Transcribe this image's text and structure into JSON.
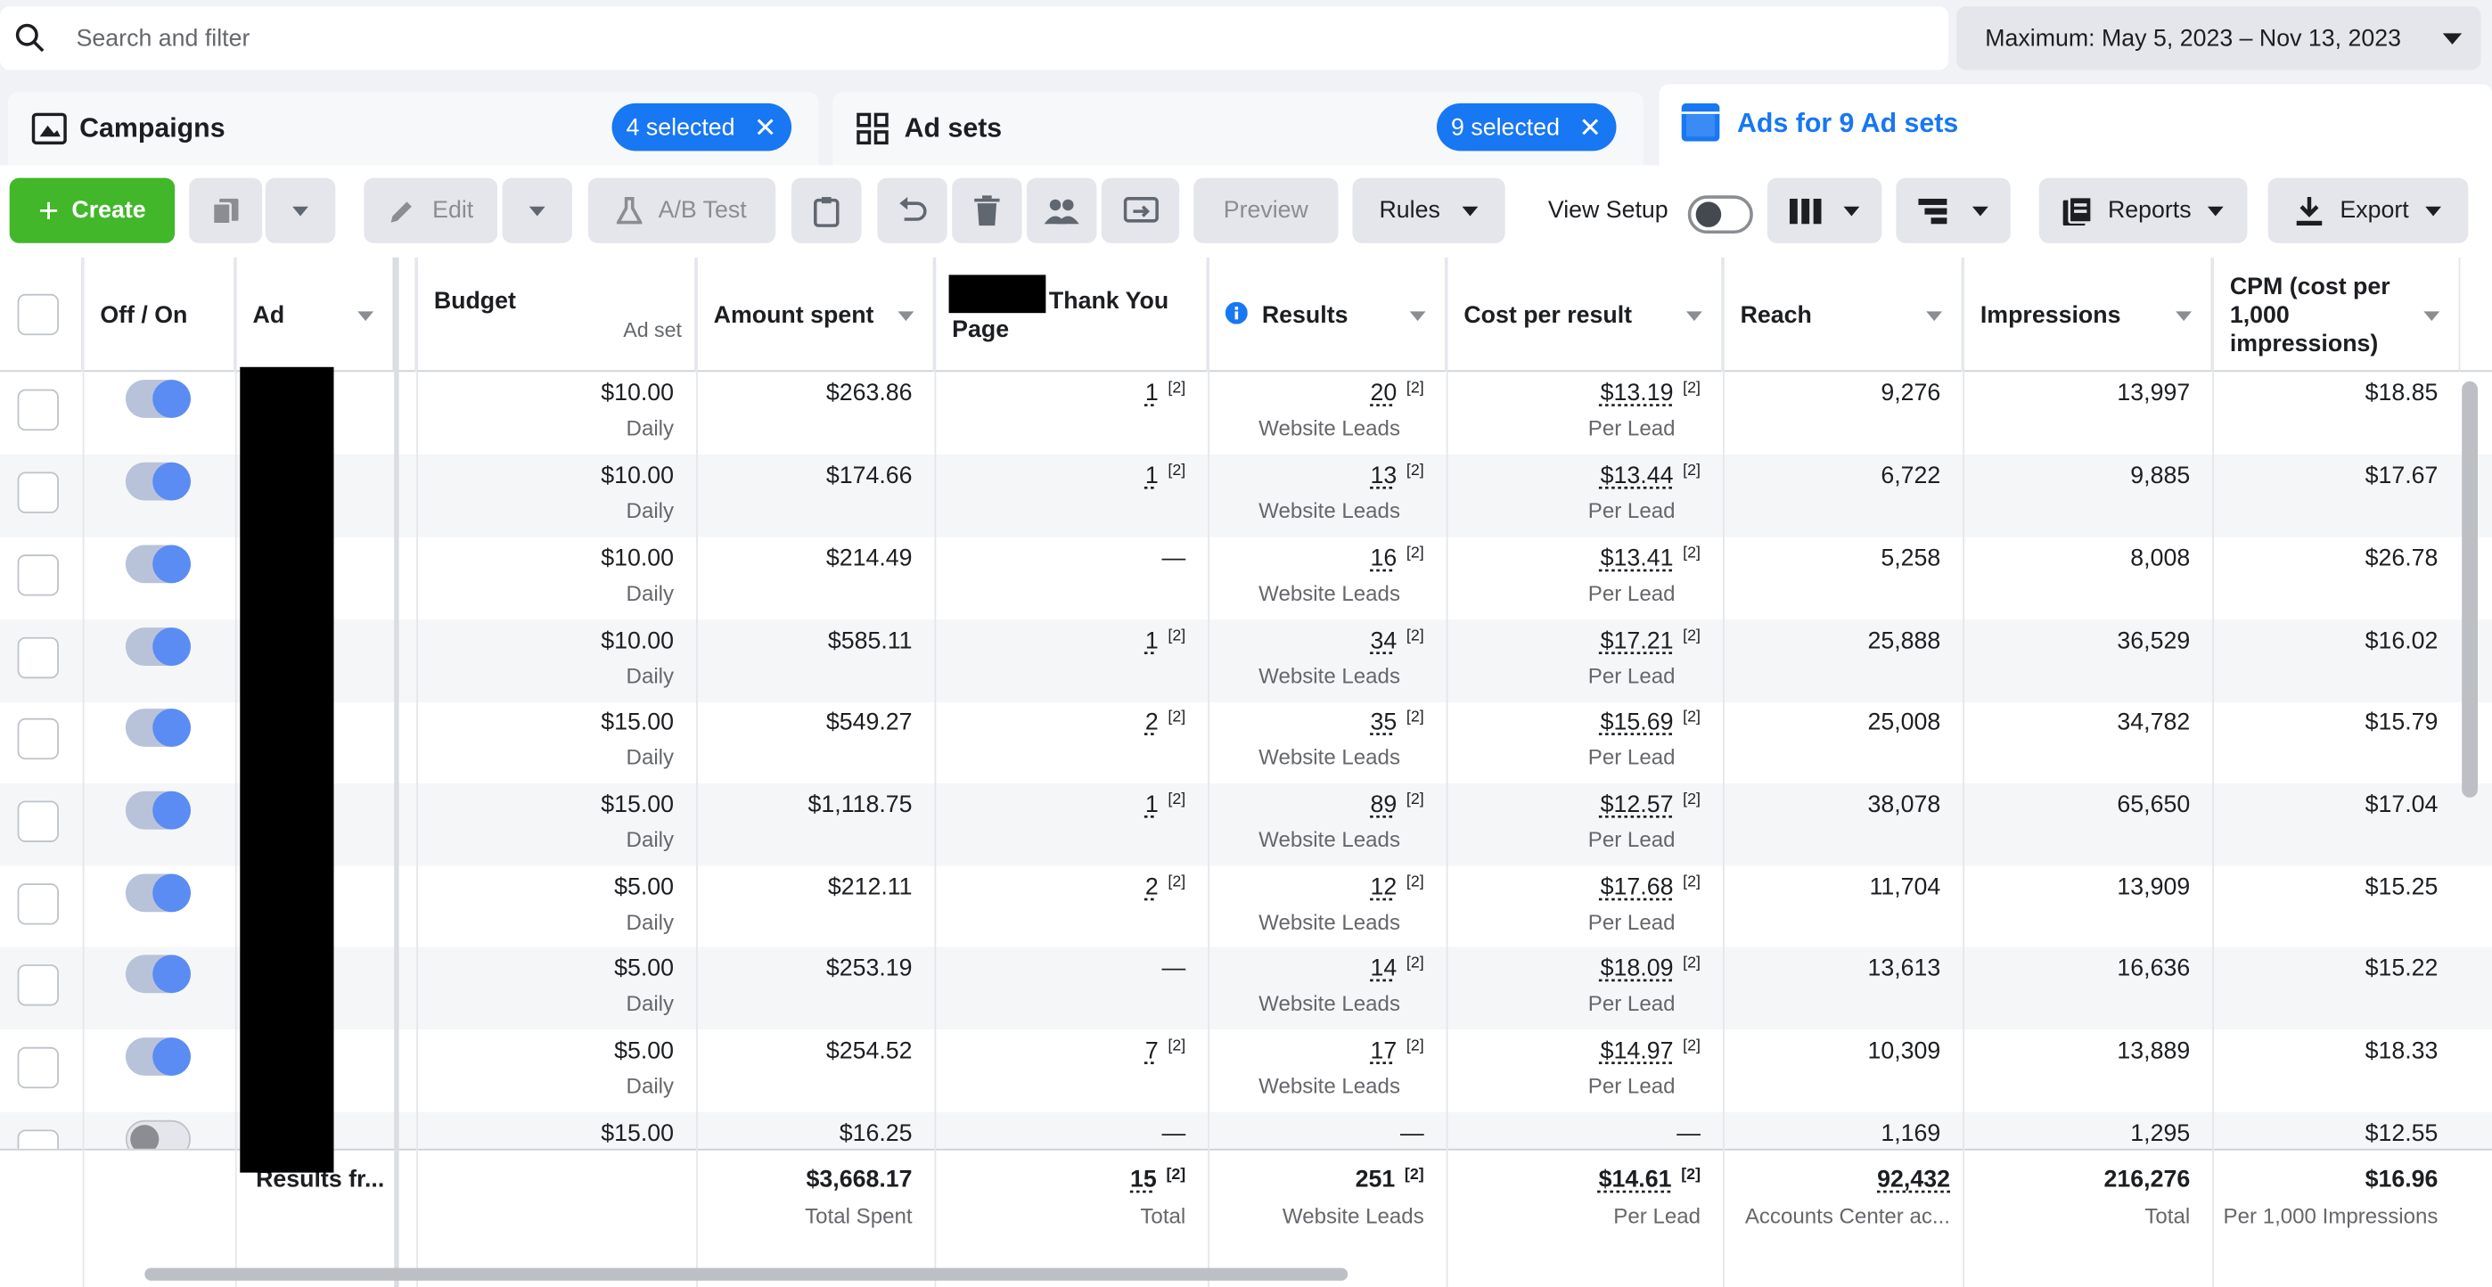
{
  "search": {
    "placeholder": "Search and filter"
  },
  "date_range": "Maximum: May 5, 2023 – Nov 13, 2023",
  "tabs": [
    {
      "label": "Campaigns",
      "selected": "4 selected"
    },
    {
      "label": "Ad sets",
      "selected": "9 selected"
    },
    {
      "label": "Ads for 9 Ad sets"
    }
  ],
  "toolbar": {
    "create": "Create",
    "edit": "Edit",
    "ab_test": "A/B Test",
    "preview": "Preview",
    "rules": "Rules",
    "view_setup": "View Setup",
    "reports": "Reports",
    "export": "Export"
  },
  "columns": {
    "onoff": "Off / On",
    "ad": "Ad",
    "budget": "Budget",
    "budget_sub": "Ad set",
    "amount_spent": "Amount spent",
    "thank_you": "Thank You",
    "thank_you_2": "Page",
    "results": "Results",
    "cost_per_result": "Cost per result",
    "reach": "Reach",
    "impressions": "Impressions",
    "cpm": "CPM (cost per",
    "cpm_2": "1,000",
    "cpm_3": "impressions)"
  },
  "rows": [
    {
      "on": true,
      "budget": "$10.00",
      "budget_sub": "Daily",
      "spent": "$263.86",
      "thank": "1",
      "thank_fn": "[2]",
      "results": "20",
      "results_fn": "[2]",
      "results_sub": "Website Leads",
      "cpr": "$13.19",
      "cpr_fn": "[2]",
      "cpr_sub": "Per Lead",
      "reach": "9,276",
      "impr": "13,997",
      "cpm": "$18.85"
    },
    {
      "on": true,
      "budget": "$10.00",
      "budget_sub": "Daily",
      "spent": "$174.66",
      "thank": "1",
      "thank_fn": "[2]",
      "results": "13",
      "results_fn": "[2]",
      "results_sub": "Website Leads",
      "cpr": "$13.44",
      "cpr_fn": "[2]",
      "cpr_sub": "Per Lead",
      "reach": "6,722",
      "impr": "9,885",
      "cpm": "$17.67"
    },
    {
      "on": true,
      "budget": "$10.00",
      "budget_sub": "Daily",
      "spent": "$214.49",
      "thank": "—",
      "thank_fn": "",
      "results": "16",
      "results_fn": "[2]",
      "results_sub": "Website Leads",
      "cpr": "$13.41",
      "cpr_fn": "[2]",
      "cpr_sub": "Per Lead",
      "reach": "5,258",
      "impr": "8,008",
      "cpm": "$26.78"
    },
    {
      "on": true,
      "budget": "$10.00",
      "budget_sub": "Daily",
      "spent": "$585.11",
      "thank": "1",
      "thank_fn": "[2]",
      "results": "34",
      "results_fn": "[2]",
      "results_sub": "Website Leads",
      "cpr": "$17.21",
      "cpr_fn": "[2]",
      "cpr_sub": "Per Lead",
      "reach": "25,888",
      "impr": "36,529",
      "cpm": "$16.02"
    },
    {
      "on": true,
      "budget": "$15.00",
      "budget_sub": "Daily",
      "spent": "$549.27",
      "thank": "2",
      "thank_fn": "[2]",
      "results": "35",
      "results_fn": "[2]",
      "results_sub": "Website Leads",
      "cpr": "$15.69",
      "cpr_fn": "[2]",
      "cpr_sub": "Per Lead",
      "reach": "25,008",
      "impr": "34,782",
      "cpm": "$15.79"
    },
    {
      "on": true,
      "budget": "$15.00",
      "budget_sub": "Daily",
      "spent": "$1,118.75",
      "thank": "1",
      "thank_fn": "[2]",
      "results": "89",
      "results_fn": "[2]",
      "results_sub": "Website Leads",
      "cpr": "$12.57",
      "cpr_fn": "[2]",
      "cpr_sub": "Per Lead",
      "reach": "38,078",
      "impr": "65,650",
      "cpm": "$17.04"
    },
    {
      "on": true,
      "budget": "$5.00",
      "budget_sub": "Daily",
      "spent": "$212.11",
      "thank": "2",
      "thank_fn": "[2]",
      "results": "12",
      "results_fn": "[2]",
      "results_sub": "Website Leads",
      "cpr": "$17.68",
      "cpr_fn": "[2]",
      "cpr_sub": "Per Lead",
      "reach": "11,704",
      "impr": "13,909",
      "cpm": "$15.25"
    },
    {
      "on": true,
      "budget": "$5.00",
      "budget_sub": "Daily",
      "spent": "$253.19",
      "thank": "—",
      "thank_fn": "",
      "results": "14",
      "results_fn": "[2]",
      "results_sub": "Website Leads",
      "cpr": "$18.09",
      "cpr_fn": "[2]",
      "cpr_sub": "Per Lead",
      "reach": "13,613",
      "impr": "16,636",
      "cpm": "$15.22"
    },
    {
      "on": true,
      "budget": "$5.00",
      "budget_sub": "Daily",
      "spent": "$254.52",
      "thank": "7",
      "thank_fn": "[2]",
      "results": "17",
      "results_fn": "[2]",
      "results_sub": "Website Leads",
      "cpr": "$14.97",
      "cpr_fn": "[2]",
      "cpr_sub": "Per Lead",
      "reach": "10,309",
      "impr": "13,889",
      "cpm": "$18.33"
    },
    {
      "on": false,
      "budget": "$15.00",
      "budget_sub": "",
      "spent": "$16.25",
      "thank": "—",
      "thank_fn": "",
      "results": "—",
      "results_fn": "",
      "results_sub": "",
      "cpr": "—",
      "cpr_fn": "",
      "cpr_sub": "",
      "reach": "1,169",
      "impr": "1,295",
      "cpm": "$12.55"
    }
  ],
  "totals": {
    "label": "Results fr...",
    "spent": "$3,668.17",
    "spent_sub": "Total Spent",
    "thank": "15",
    "thank_fn": "[2]",
    "thank_sub": "Total",
    "results": "251",
    "results_fn": "[2]",
    "results_sub": "Website Leads",
    "cpr": "$14.61",
    "cpr_fn": "[2]",
    "cpr_sub": "Per Lead",
    "reach": "92,432",
    "reach_sub": "Accounts Center ac...",
    "impr": "216,276",
    "impr_sub": "Total",
    "cpm": "$16.96",
    "cpm_sub": "Per 1,000 Impressions"
  },
  "colors": {
    "accent": "#1877f2",
    "create": "#42b72a",
    "toggle_on": "#5b8cf3"
  }
}
